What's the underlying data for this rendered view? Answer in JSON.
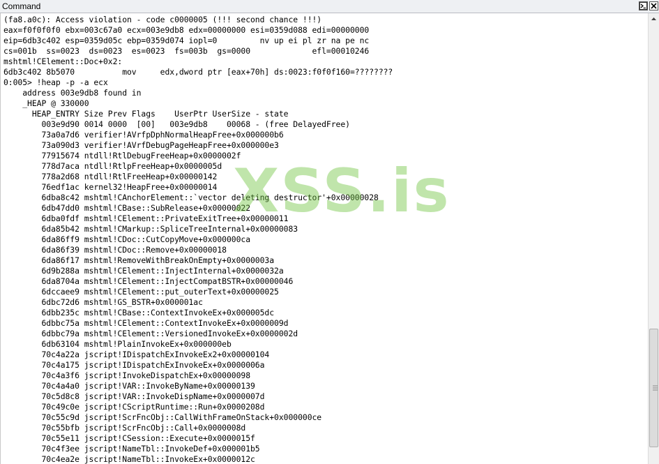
{
  "window": {
    "title": "Command"
  },
  "toolbar": {
    "icons": [
      "command-window-icon",
      "close-icon"
    ]
  },
  "watermark": {
    "text": "XSS.is",
    "color": "#6cc33a"
  },
  "output": {
    "lines": [
      "(fa8.a0c): Access violation - code c0000005 (!!! second chance !!!)",
      "eax=f0f0f0f0 ebx=003c67a0 ecx=003e9db8 edx=00000000 esi=0359d088 edi=00000000",
      "eip=6db3c402 esp=0359d05c ebp=0359d074 iopl=0         nv up ei pl zr na pe nc",
      "cs=001b  ss=0023  ds=0023  es=0023  fs=003b  gs=0000             efl=00010246",
      "mshtml!CElement::Doc+0x2:",
      "6db3c402 8b5070          mov     edx,dword ptr [eax+70h] ds:0023:f0f0f160=????????",
      "0:005> !heap -p -a ecx",
      "    address 003e9db8 found in",
      "    _HEAP @ 330000",
      "      HEAP_ENTRY Size Prev Flags    UserPtr UserSize - state",
      "        003e9d90 0014 0000  [00]   003e9db8    00068 - (free DelayedFree)",
      "        73a0a7d6 verifier!AVrfpDphNormalHeapFree+0x000000b6",
      "        73a090d3 verifier!AVrfDebugPageHeapFree+0x000000e3",
      "        77915674 ntdll!RtlDebugFreeHeap+0x0000002f",
      "        778d7aca ntdll!RtlpFreeHeap+0x0000005d",
      "        778a2d68 ntdll!RtlFreeHeap+0x00000142",
      "        76edf1ac kernel32!HeapFree+0x00000014",
      "        6dba8c42 mshtml!CAnchorElement::`vector deleting destructor'+0x00000028",
      "        6db47dd0 mshtml!CBase::SubRelease+0x00000022",
      "        6dba0fdf mshtml!CElement::PrivateExitTree+0x00000011",
      "        6da85b42 mshtml!CMarkup::SpliceTreeInternal+0x00000083",
      "        6da86ff9 mshtml!CDoc::CutCopyMove+0x000000ca",
      "        6da86f39 mshtml!CDoc::Remove+0x00000018",
      "        6da86f17 mshtml!RemoveWithBreakOnEmpty+0x0000003a",
      "        6d9b288a mshtml!CElement::InjectInternal+0x0000032a",
      "        6da8704a mshtml!CElement::InjectCompatBSTR+0x00000046",
      "        6dccaee9 mshtml!CElement::put_outerText+0x00000025",
      "        6dbc72d6 mshtml!GS_BSTR+0x000001ac",
      "        6dbb235c mshtml!CBase::ContextInvokeEx+0x000005dc",
      "        6dbbc75a mshtml!CElement::ContextInvokeEx+0x0000009d",
      "        6dbbc79a mshtml!CElement::VersionedInvokeEx+0x0000002d",
      "        6db63104 mshtml!PlainInvokeEx+0x000000eb",
      "        70c4a22a jscript!IDispatchExInvokeEx2+0x00000104",
      "        70c4a175 jscript!IDispatchExInvokeEx+0x0000006a",
      "        70c4a3f6 jscript!InvokeDispatchEx+0x00000098",
      "        70c4a4a0 jscript!VAR::InvokeByName+0x00000139",
      "        70c5d8c8 jscript!VAR::InvokeDispName+0x0000007d",
      "        70c49c0e jscript!CScriptRuntime::Run+0x0000208d",
      "        70c55c9d jscript!ScrFncObj::CallWithFrameOnStack+0x000000ce",
      "        70c55bfb jscript!ScrFncObj::Call+0x0000008d",
      "        70c55e11 jscript!CSession::Execute+0x0000015f",
      "        70c4f3ee jscript!NameTbl::InvokeDef+0x000001b5",
      "        70c4ea2e jscript!NameTbl::InvokeEx+0x0000012c"
    ]
  }
}
